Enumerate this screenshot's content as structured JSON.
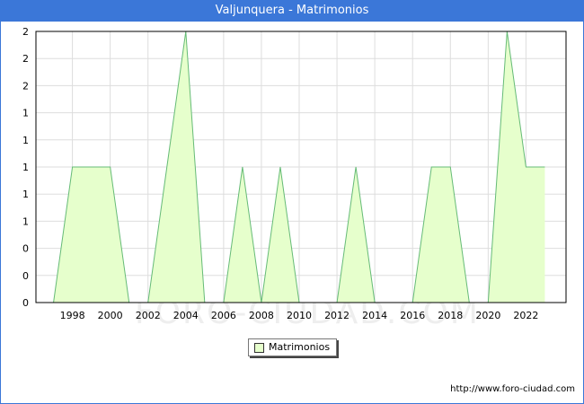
{
  "window": {
    "title": "Valjunquera - Matrimonios"
  },
  "footer": {
    "url": "http://www.foro-ciudad.com"
  },
  "watermark": {
    "text": "FORO-CIUDAD.COM"
  },
  "chart_data": {
    "type": "area",
    "title": "Valjunquera - Matrimonios",
    "xlabel": "",
    "ylabel": "",
    "x": [
      1997,
      1998,
      1999,
      2000,
      2001,
      2002,
      2003,
      2004,
      2005,
      2006,
      2007,
      2008,
      2009,
      2010,
      2011,
      2012,
      2013,
      2014,
      2015,
      2016,
      2017,
      2018,
      2019,
      2020,
      2021,
      2022,
      2023
    ],
    "series": [
      {
        "name": "Matrimonios",
        "values": [
          0,
          1,
          1,
          1,
          0,
          0,
          1,
          2,
          0,
          0,
          1,
          0,
          1,
          0,
          0,
          0,
          1,
          0,
          0,
          0,
          1,
          1,
          0,
          0,
          2,
          1,
          1
        ]
      }
    ],
    "xticks": [
      "1998",
      "2000",
      "2002",
      "2004",
      "2006",
      "2008",
      "2010",
      "2012",
      "2014",
      "2016",
      "2018",
      "2020",
      "2022"
    ],
    "yticks": [
      "0",
      "0",
      "0",
      "1",
      "1",
      "1",
      "1",
      "1",
      "2",
      "2",
      "2"
    ],
    "xlim": [
      1996.07,
      2024.12
    ],
    "ylim": [
      0,
      2
    ],
    "grid": true,
    "legend": "bottom-center",
    "colors": {
      "fill": "#e6ffcc",
      "line": "#66bb77",
      "grid": "#dddddd",
      "axis": "#000000",
      "header": "#3b77d8"
    }
  }
}
